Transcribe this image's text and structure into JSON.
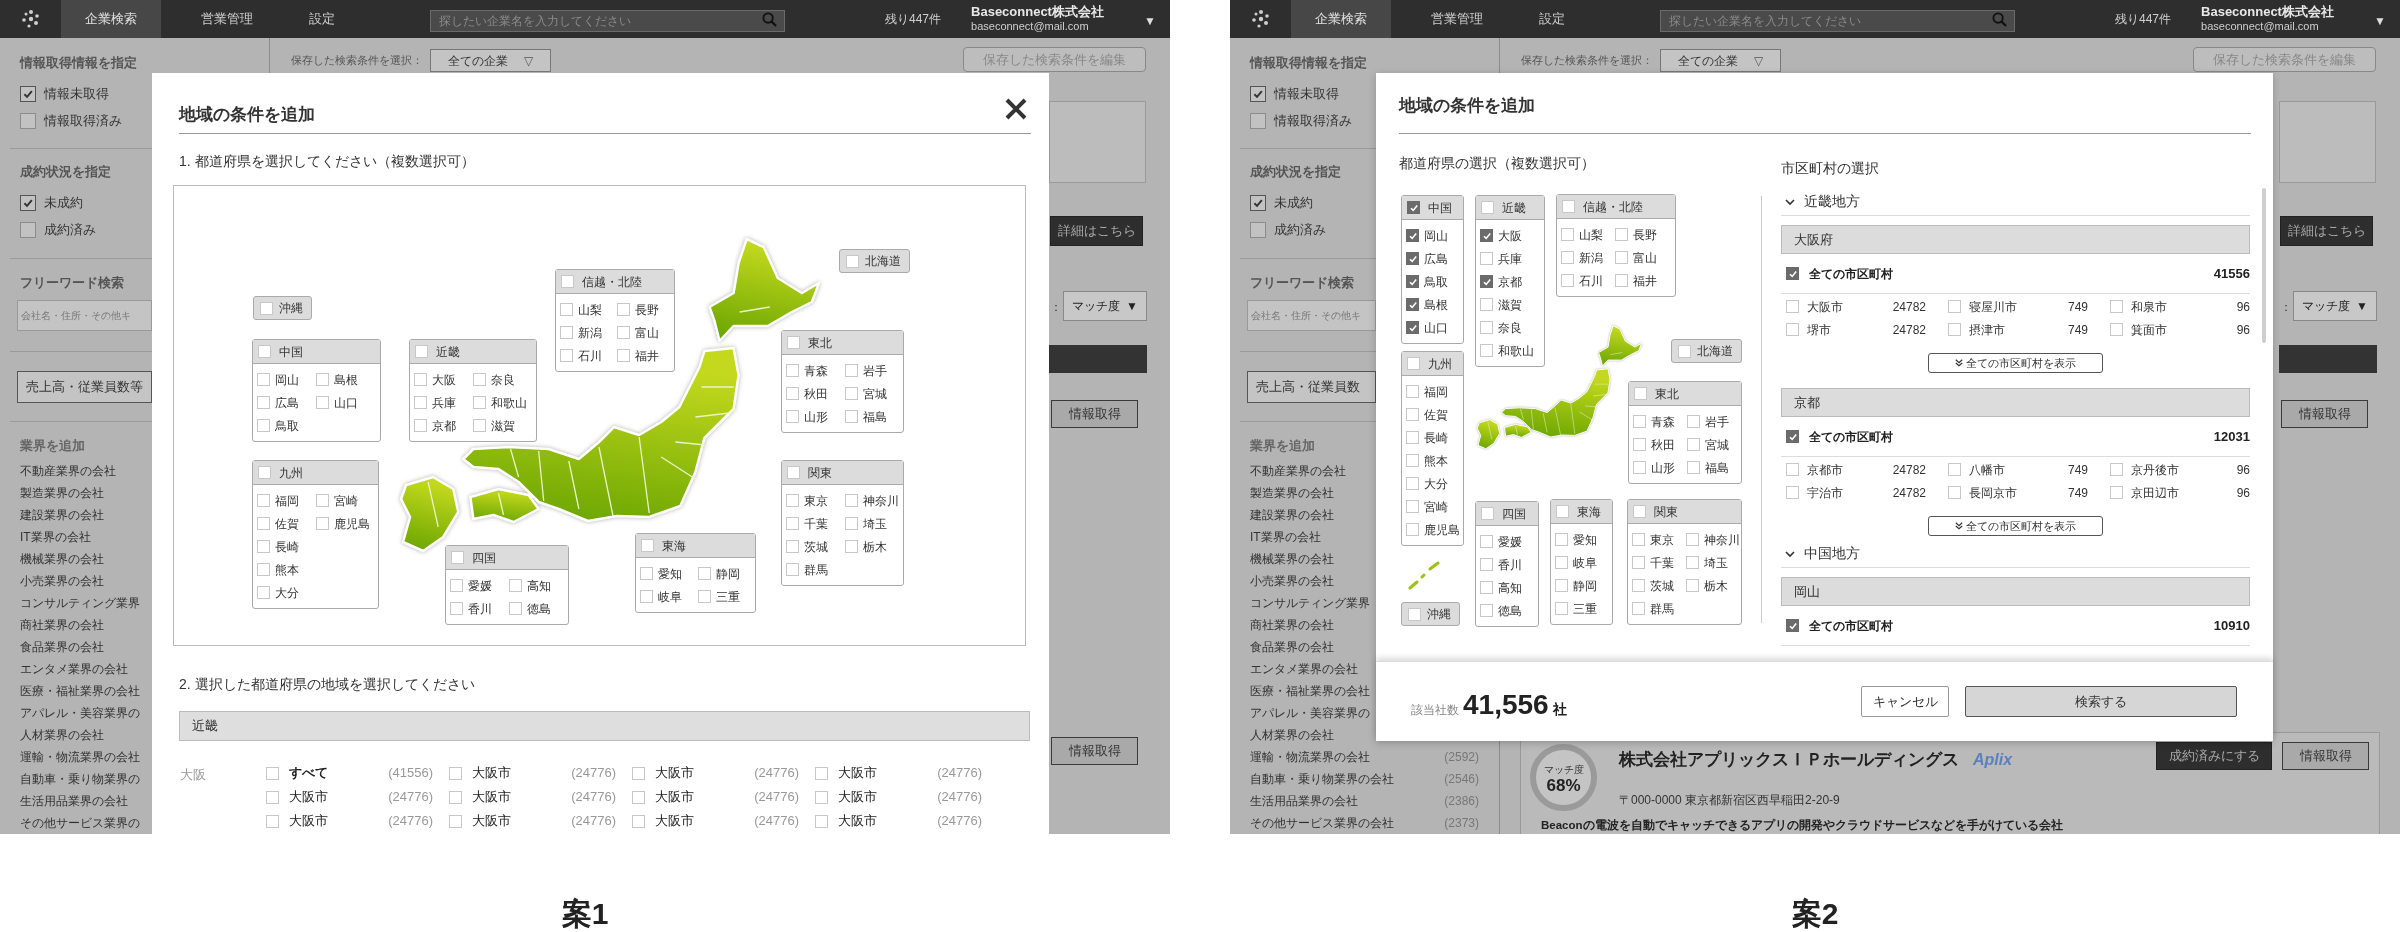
{
  "mockups": [
    {
      "caption": "案1",
      "app": {
        "nav": {
          "tabs": [
            {
              "label": "企業検索",
              "selected": true
            },
            {
              "label": "営業管理",
              "selected": false
            },
            {
              "label": "設定",
              "selected": false
            }
          ],
          "search_placeholder": "探したい企業名を入力してください",
          "remaining": "残り447件",
          "company": "Baseconnect株式会社",
          "email": "baseconnect@mail.com",
          "menu_caret": "▼"
        },
        "sidebar": {
          "sections": [
            {
              "title": "情報取得情報を指定",
              "options": [
                {
                  "label": "情報未取得",
                  "checked": true
                },
                {
                  "label": "情報取得済み",
                  "checked": false
                }
              ]
            },
            {
              "title": "成約状況を指定",
              "options": [
                {
                  "label": "未成約",
                  "checked": true
                },
                {
                  "label": "成約済み",
                  "checked": false
                }
              ]
            }
          ],
          "freeword_title": "フリーワード検索",
          "freeword_placeholder": "会社名・住所・その他キ",
          "filter_button": "売上高・従業員数等",
          "industry_title": "業界を追加",
          "industries": [
            {
              "label": "不動産業界の会社"
            },
            {
              "label": "製造業界の会社"
            },
            {
              "label": "建設業界の会社"
            },
            {
              "label": "IT業界の会社"
            },
            {
              "label": "機械業界の会社"
            },
            {
              "label": "小売業界の会社"
            },
            {
              "label": "コンサルティング業界"
            },
            {
              "label": "商社業界の会社"
            },
            {
              "label": "食品業界の会社"
            },
            {
              "label": "エンタメ業界の会社"
            },
            {
              "label": "医療・福祉業界の会社"
            },
            {
              "label": "アパレル・美容業界の"
            },
            {
              "label": "人材業界の会社"
            },
            {
              "label": "運輸・物流業界の会社"
            },
            {
              "label": "自動車・乗り物業界の"
            },
            {
              "label": "生活用品業界の会社"
            },
            {
              "label": "その他サービス業界の"
            }
          ]
        },
        "main": {
          "saved_label": "保存した検索条件を選択：",
          "saved_value": "全ての企業",
          "saved_caret": "▽",
          "edit_button": "保存した検索条件を編集",
          "detail_button": "詳細はこちら",
          "sort_label": "：",
          "sort_value": "マッチ度",
          "sort_caret": "▼",
          "fetch_buttons": [
            "情報取得",
            "情報取得"
          ]
        }
      },
      "modal": {
        "kind": "map",
        "title": "地域の条件を追加",
        "step1": "1. 都道府県を選択してください（複数選択可）",
        "regions": [
          {
            "kind": "pill",
            "name": "沖縄",
            "checked": false
          },
          {
            "kind": "box",
            "name": "中国",
            "checked": false,
            "columns": [
              [
                {
                  "name": "岡山",
                  "checked": false
                },
                {
                  "name": "広島",
                  "checked": false
                },
                {
                  "name": "鳥取",
                  "checked": false
                }
              ],
              [
                {
                  "name": "島根",
                  "checked": false
                },
                {
                  "name": "山口",
                  "checked": false
                }
              ]
            ]
          },
          {
            "kind": "box",
            "name": "近畿",
            "checked": false,
            "columns": [
              [
                {
                  "name": "大阪",
                  "checked": false
                },
                {
                  "name": "兵庫",
                  "checked": false
                },
                {
                  "name": "京都",
                  "checked": false
                }
              ],
              [
                {
                  "name": "奈良",
                  "checked": false
                },
                {
                  "name": "和歌山",
                  "checked": false
                },
                {
                  "name": "滋賀",
                  "checked": false
                }
              ]
            ]
          },
          {
            "kind": "box",
            "name": "信越・北陸",
            "checked": false,
            "columns": [
              [
                {
                  "name": "山梨",
                  "checked": false
                },
                {
                  "name": "新潟",
                  "checked": false
                },
                {
                  "name": "石川",
                  "checked": false
                }
              ],
              [
                {
                  "name": "長野",
                  "checked": false
                },
                {
                  "name": "富山",
                  "checked": false
                },
                {
                  "name": "福井",
                  "checked": false
                }
              ]
            ]
          },
          {
            "kind": "pill",
            "name": "北海道",
            "checked": false
          },
          {
            "kind": "box",
            "name": "東北",
            "checked": false,
            "columns": [
              [
                {
                  "name": "青森",
                  "checked": false
                },
                {
                  "name": "秋田",
                  "checked": false
                },
                {
                  "name": "山形",
                  "checked": false
                }
              ],
              [
                {
                  "name": "岩手",
                  "checked": false
                },
                {
                  "name": "宮城",
                  "checked": false
                },
                {
                  "name": "福島",
                  "checked": false
                }
              ]
            ]
          },
          {
            "kind": "box",
            "name": "九州",
            "checked": false,
            "columns": [
              [
                {
                  "name": "福岡",
                  "checked": false
                },
                {
                  "name": "佐賀",
                  "checked": false
                },
                {
                  "name": "長崎",
                  "checked": false
                },
                {
                  "name": "熊本",
                  "checked": false
                },
                {
                  "name": "大分",
                  "checked": false
                }
              ],
              [
                {
                  "name": "宮崎",
                  "checked": false
                },
                {
                  "name": "鹿児島",
                  "checked": false
                }
              ]
            ]
          },
          {
            "kind": "box",
            "name": "四国",
            "checked": false,
            "columns": [
              [
                {
                  "name": "愛媛",
                  "checked": false
                },
                {
                  "name": "香川",
                  "checked": false
                }
              ],
              [
                {
                  "name": "高知",
                  "checked": false
                },
                {
                  "name": "徳島",
                  "checked": false
                }
              ]
            ]
          },
          {
            "kind": "box",
            "name": "東海",
            "checked": false,
            "columns": [
              [
                {
                  "name": "愛知",
                  "checked": false
                },
                {
                  "name": "岐阜",
                  "checked": false
                }
              ],
              [
                {
                  "name": "静岡",
                  "checked": false
                },
                {
                  "name": "三重",
                  "checked": false
                }
              ]
            ]
          },
          {
            "kind": "box",
            "name": "関東",
            "checked": false,
            "columns": [
              [
                {
                  "name": "東京",
                  "checked": false
                },
                {
                  "name": "千葉",
                  "checked": false
                },
                {
                  "name": "茨城",
                  "checked": false
                },
                {
                  "name": "群馬",
                  "checked": false
                }
              ],
              [
                {
                  "name": "神奈川",
                  "checked": false
                },
                {
                  "name": "埼玉",
                  "checked": false
                },
                {
                  "name": "栃木",
                  "checked": false
                }
              ]
            ]
          }
        ],
        "step2": "2. 選択した都道府県の地域を選択してください",
        "area": {
          "name": "近畿",
          "prefecture": "大阪",
          "rows": [
            {
              "cells": [
                {
                  "kind": "all",
                  "label": "すべて",
                  "count": "(41556)",
                  "checked": false
                },
                {
                  "kind": "city",
                  "label": "大阪市",
                  "count": "(24776)",
                  "checked": false
                },
                {
                  "kind": "city",
                  "label": "大阪市",
                  "count": "(24776)",
                  "checked": false
                },
                {
                  "kind": "city",
                  "label": "大阪市",
                  "count": "(24776)",
                  "checked": false
                }
              ]
            },
            {
              "cells": [
                {
                  "kind": "city",
                  "label": "大阪市",
                  "count": "(24776)",
                  "checked": false
                },
                {
                  "kind": "city",
                  "label": "大阪市",
                  "count": "(24776)",
                  "checked": false
                },
                {
                  "kind": "city",
                  "label": "大阪市",
                  "count": "(24776)",
                  "checked": false
                },
                {
                  "kind": "city",
                  "label": "大阪市",
                  "count": "(24776)",
                  "checked": false
                }
              ]
            },
            {
              "cells": [
                {
                  "kind": "city",
                  "label": "大阪市",
                  "count": "(24776)",
                  "checked": false
                },
                {
                  "kind": "city",
                  "label": "大阪市",
                  "count": "(24776)",
                  "checked": false
                },
                {
                  "kind": "city",
                  "label": "大阪市",
                  "count": "(24776)",
                  "checked": false
                },
                {
                  "kind": "city",
                  "label": "大阪市",
                  "count": "(24776)",
                  "checked": false
                }
              ]
            }
          ]
        }
      }
    },
    {
      "caption": "案2",
      "app": {
        "nav": {
          "tabs": [
            {
              "label": "企業検索",
              "selected": true
            },
            {
              "label": "営業管理",
              "selected": false
            },
            {
              "label": "設定",
              "selected": false
            }
          ],
          "search_placeholder": "探したい企業名を入力してください",
          "remaining": "残り447件",
          "company": "Baseconnect株式会社",
          "email": "baseconnect@mail.com",
          "menu_caret": "▼"
        },
        "sidebar": {
          "sections": [
            {
              "title": "情報取得情報を指定",
              "options": [
                {
                  "label": "情報未取得",
                  "checked": true
                },
                {
                  "label": "情報取得済み",
                  "checked": false
                }
              ]
            },
            {
              "title": "成約状況を指定",
              "options": [
                {
                  "label": "未成約",
                  "checked": true
                },
                {
                  "label": "成約済み",
                  "checked": false
                }
              ]
            }
          ],
          "freeword_title": "フリーワード検索",
          "freeword_placeholder": "会社名・住所・その他キ",
          "filter_button": "売上高・従業員数",
          "industry_title": "業界を追加",
          "industries": [
            {
              "label": "不動産業界の会社"
            },
            {
              "label": "製造業界の会社"
            },
            {
              "label": "建設業界の会社"
            },
            {
              "label": "IT業界の会社"
            },
            {
              "label": "機械業界の会社"
            },
            {
              "label": "小売業界の会社"
            },
            {
              "label": "コンサルティング業界"
            },
            {
              "label": "商社業界の会社"
            },
            {
              "label": "食品業界の会社"
            },
            {
              "label": "エンタメ業界の会社"
            },
            {
              "label": "医療・福祉業界の会社"
            },
            {
              "label": "アパレル・美容業界の"
            },
            {
              "label": "人材業界の会社"
            },
            {
              "label": "運輸・物流業界の会社",
              "count": "(2592)"
            },
            {
              "label": "自動車・乗り物業界の会社",
              "count": "(2546)"
            },
            {
              "label": "生活用品業界の会社",
              "count": "(2386)"
            },
            {
              "label": "その他サービス業界の会社",
              "count": "(2373)"
            }
          ]
        },
        "main": {
          "saved_label": "保存した検索条件を選択：",
          "saved_value": "全ての企業",
          "saved_caret": "▽",
          "edit_button": "保存した検索条件を編集",
          "detail_button": "詳細はこちら",
          "sort_label": "：",
          "sort_value": "マッチ度",
          "sort_caret": "▼",
          "fetch_buttons": [
            "情報取得"
          ],
          "card": {
            "match_label": "マッチ度",
            "match_score": "68%",
            "name": "株式会社アプリックスＩＰホールディングス",
            "logo": "Aplix",
            "close_button": "成約済みにする",
            "fetch_button": "情報取得",
            "address": "〒000-0000 東京都新宿区西早稲田2-20-9",
            "description": "Beaconの電波を自動でキャッチできるアプリの開発やクラウドサービスなどを手がけている会社"
          }
        }
      },
      "modal": {
        "kind": "split",
        "title": "地域の条件を追加",
        "pref_title": "都道府県の選択（複数選択可）",
        "city_title": "市区町村の選択",
        "regions": [
          {
            "kind": "box",
            "name": "中国",
            "checked": true,
            "columns": [
              [
                {
                  "name": "岡山",
                  "checked": true
                },
                {
                  "name": "広島",
                  "checked": true
                },
                {
                  "name": "鳥取",
                  "checked": true
                },
                {
                  "name": "島根",
                  "checked": true
                },
                {
                  "name": "山口",
                  "checked": true
                }
              ]
            ]
          },
          {
            "kind": "box",
            "name": "近畿",
            "checked": false,
            "columns": [
              [
                {
                  "name": "大阪",
                  "checked": true
                },
                {
                  "name": "兵庫",
                  "checked": false
                },
                {
                  "name": "京都",
                  "checked": true
                },
                {
                  "name": "滋賀",
                  "checked": false
                },
                {
                  "name": "奈良",
                  "checked": false
                },
                {
                  "name": "和歌山",
                  "checked": false
                }
              ]
            ]
          },
          {
            "kind": "box",
            "name": "信越・北陸",
            "checked": false,
            "columns": [
              [
                {
                  "name": "山梨",
                  "checked": false
                },
                {
                  "name": "新潟",
                  "checked": false
                },
                {
                  "name": "石川",
                  "checked": false
                }
              ],
              [
                {
                  "name": "長野",
                  "checked": false
                },
                {
                  "name": "富山",
                  "checked": false
                },
                {
                  "name": "福井",
                  "checked": false
                }
              ]
            ]
          },
          {
            "kind": "box",
            "name": "九州",
            "checked": false,
            "columns": [
              [
                {
                  "name": "福岡",
                  "checked": false
                },
                {
                  "name": "佐賀",
                  "checked": false
                },
                {
                  "name": "長崎",
                  "checked": false
                },
                {
                  "name": "熊本",
                  "checked": false
                },
                {
                  "name": "大分",
                  "checked": false
                },
                {
                  "name": "宮崎",
                  "checked": false
                },
                {
                  "name": "鹿児島",
                  "checked": false
                }
              ]
            ]
          },
          {
            "kind": "pill",
            "name": "北海道",
            "checked": false
          },
          {
            "kind": "box",
            "name": "東北",
            "checked": false,
            "columns": [
              [
                {
                  "name": "青森",
                  "checked": false
                },
                {
                  "name": "秋田",
                  "checked": false
                },
                {
                  "name": "山形",
                  "checked": false
                }
              ],
              [
                {
                  "name": "岩手",
                  "checked": false
                },
                {
                  "name": "宮城",
                  "checked": false
                },
                {
                  "name": "福島",
                  "checked": false
                }
              ]
            ]
          },
          {
            "kind": "pill",
            "name": "沖縄",
            "checked": false
          },
          {
            "kind": "box",
            "name": "四国",
            "checked": false,
            "columns": [
              [
                {
                  "name": "愛媛",
                  "checked": false
                },
                {
                  "name": "香川",
                  "checked": false
                },
                {
                  "name": "高知",
                  "checked": false
                },
                {
                  "name": "徳島",
                  "checked": false
                }
              ]
            ]
          },
          {
            "kind": "box",
            "name": "東海",
            "checked": false,
            "columns": [
              [
                {
                  "name": "愛知",
                  "checked": false
                },
                {
                  "name": "岐阜",
                  "checked": false
                },
                {
                  "name": "静岡",
                  "checked": false
                },
                {
                  "name": "三重",
                  "checked": false
                }
              ]
            ]
          },
          {
            "kind": "box",
            "name": "関東",
            "checked": false,
            "columns": [
              [
                {
                  "name": "東京",
                  "checked": false
                },
                {
                  "name": "千葉",
                  "checked": false
                },
                {
                  "name": "茨城",
                  "checked": false
                },
                {
                  "name": "群馬",
                  "checked": false
                }
              ],
              [
                {
                  "name": "神奈川",
                  "checked": false
                },
                {
                  "name": "埼玉",
                  "checked": false
                },
                {
                  "name": "栃木",
                  "checked": false
                }
              ]
            ]
          }
        ],
        "city_groups": [
          {
            "name": "近畿地方",
            "expanded": true,
            "prefectures": [
              {
                "name": "大阪府",
                "all": {
                  "label": "全ての市区町村",
                  "count": "41556",
                  "checked": true
                },
                "cities": [
                  {
                    "name": "大阪市",
                    "count": "24782",
                    "checked": false
                  },
                  {
                    "name": "寝屋川市",
                    "count": "749",
                    "checked": false
                  },
                  {
                    "name": "和泉市",
                    "count": "96",
                    "checked": false
                  },
                  {
                    "name": "堺市",
                    "count": "24782",
                    "checked": false
                  },
                  {
                    "name": "摂津市",
                    "count": "749",
                    "checked": false
                  },
                  {
                    "name": "箕面市",
                    "count": "96",
                    "checked": false
                  }
                ],
                "more_button": "全ての市区町村を表示"
              },
              {
                "name": "京都",
                "all": {
                  "label": "全ての市区町村",
                  "count": "12031",
                  "checked": true
                },
                "cities": [
                  {
                    "name": "京都市",
                    "count": "24782",
                    "checked": false
                  },
                  {
                    "name": "八幡市",
                    "count": "749",
                    "checked": false
                  },
                  {
                    "name": "京丹後市",
                    "count": "96",
                    "checked": false
                  },
                  {
                    "name": "宇治市",
                    "count": "24782",
                    "checked": false
                  },
                  {
                    "name": "長岡京市",
                    "count": "749",
                    "checked": false
                  },
                  {
                    "name": "京田辺市",
                    "count": "96",
                    "checked": false
                  }
                ],
                "more_button": "全ての市区町村を表示"
              }
            ]
          },
          {
            "name": "中国地方",
            "expanded": true,
            "prefectures": [
              {
                "name": "岡山",
                "all": {
                  "label": "全ての市区町村",
                  "count": "10910",
                  "checked": true
                }
              }
            ]
          }
        ],
        "footer": {
          "count_label": "該当社数",
          "count": "41,556",
          "unit": "社",
          "cancel": "キャンセル",
          "submit": "検索する"
        }
      }
    }
  ]
}
